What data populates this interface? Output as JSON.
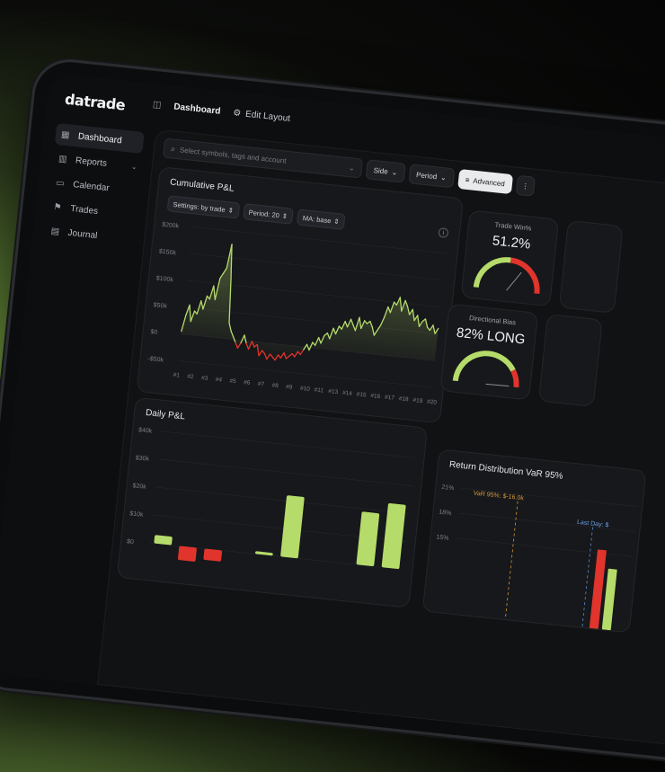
{
  "app": {
    "logo": "datrade"
  },
  "topbar": {
    "breadcrumb": "Dashboard",
    "edit_layout": "Edit Layout"
  },
  "sidebar": {
    "items": [
      {
        "label": "Dashboard",
        "icon": "grid-icon",
        "active": true
      },
      {
        "label": "Reports",
        "icon": "bar-chart-icon",
        "expandable": true
      },
      {
        "label": "Calendar",
        "icon": "calendar-icon"
      },
      {
        "label": "Trades",
        "icon": "trades-icon"
      },
      {
        "label": "Journal",
        "icon": "journal-icon"
      }
    ]
  },
  "filters": {
    "search_placeholder": "Select symbols, tags and account",
    "side": "Side",
    "period": "Period",
    "advanced": "Advanced"
  },
  "cumulative": {
    "title": "Cumulative P&L",
    "settings": "Settings: by trade",
    "period": "Period: 20",
    "ma": "MA: base"
  },
  "gauges": [
    {
      "label": "Trade Win%",
      "value": "51.2%",
      "fraction": 0.512
    },
    {
      "label": "Directional Bias",
      "value": "82% LONG",
      "fraction": 0.82
    }
  ],
  "daily": {
    "title": "Daily P&L"
  },
  "return_distribution": {
    "title": "Return Distribution VaR 95%",
    "var_label": "VaR 95%: $-16.0k",
    "last_day_label": "Last Day: $",
    "y_ticks": [
      "21%",
      "18%",
      "15%"
    ]
  },
  "colors": {
    "positive": "#b5db6a",
    "negative": "#e0342c",
    "accent": "#b5db6a"
  },
  "chart_data": [
    {
      "type": "area",
      "title": "Cumulative P&L",
      "y_ticks": [
        "$200k",
        "$150k",
        "$100k",
        "$50k",
        "$0",
        "-$50k"
      ],
      "x_ticks": [
        "#1",
        "#2",
        "#3",
        "#4",
        "#5",
        "#6",
        "#7",
        "#8",
        "#9",
        "#10",
        "#11",
        "#13",
        "#14",
        "#15",
        "#16",
        "#17",
        "#18",
        "#19",
        "#20"
      ],
      "ylim": [
        -50,
        200
      ],
      "y_unit": "k$",
      "values": [
        5,
        35,
        55,
        25,
        45,
        40,
        65,
        50,
        75,
        70,
        95,
        70,
        110,
        120,
        130,
        175,
        110,
        30,
        15,
        5,
        -5,
        -15,
        -5,
        10,
        -5,
        -15,
        0,
        -10,
        -5,
        -25,
        -15,
        -20,
        -30,
        -20,
        -25,
        -30,
        -20,
        -25,
        -15,
        -25,
        -20,
        -15,
        -20,
        -10,
        -15,
        -5,
        5,
        -5,
        10,
        5,
        20,
        10,
        25,
        30,
        20,
        40,
        30,
        45,
        40,
        55,
        45,
        60,
        50,
        40,
        65,
        45,
        60,
        55,
        60,
        50,
        35,
        45,
        55,
        70,
        90,
        80,
        100,
        95,
        110,
        85,
        105,
        95,
        80,
        90,
        70,
        80,
        60,
        70,
        75,
        60,
        55,
        65,
        50,
        60
      ]
    },
    {
      "type": "bar",
      "title": "Daily P&L",
      "y_ticks": [
        "$40k",
        "$30k",
        "$20k",
        "$10k",
        "$0"
      ],
      "ylim": [
        -10,
        40
      ],
      "values": [
        3,
        -5,
        -4,
        0,
        1,
        22,
        0,
        0,
        19,
        23
      ]
    }
  ]
}
